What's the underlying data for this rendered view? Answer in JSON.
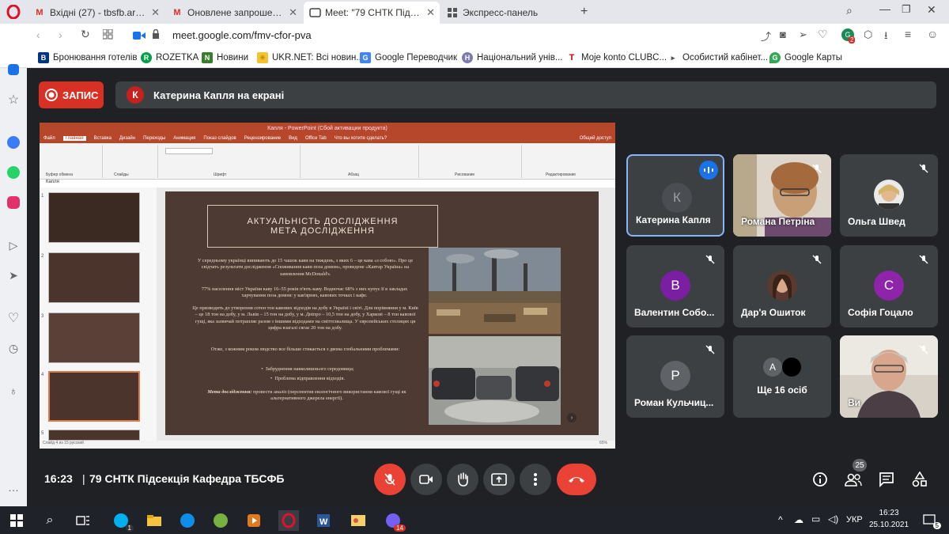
{
  "tabs": [
    {
      "title": "Вхідні (27) - tbsfb.archive@",
      "fav": "M"
    },
    {
      "title": "Оновлене запрошення: 79",
      "fav": "M"
    },
    {
      "title": "Meet: \"79 СНТК Підсекція",
      "fav": "meet"
    },
    {
      "title": "Экспресс-панель",
      "fav": "grid"
    }
  ],
  "address": {
    "url": "meet.google.com/fmv-cfor-pva",
    "ext_badge": "2"
  },
  "bookmarks": [
    {
      "label": "Бронювання готелів",
      "color": "#003580",
      "glyph": "B"
    },
    {
      "label": "ROZETKA",
      "color": "#00a046",
      "glyph": "R"
    },
    {
      "label": "Новини",
      "color": "#3a7d2c",
      "glyph": "N"
    },
    {
      "label": "UKR.NET: Всі новин...",
      "color": "#f4c430",
      "glyph": "☀"
    },
    {
      "label": "Google Переводчик",
      "color": "#4285f4",
      "glyph": "G"
    },
    {
      "label": "Національний унів...",
      "color": "#7b7bb0",
      "glyph": "Н"
    },
    {
      "label": "Moje konto CLUBC...",
      "color": "#d50000",
      "glyph": "T"
    },
    {
      "label": "Особистий кабінет...",
      "color": "#555",
      "glyph": "▸"
    },
    {
      "label": "Google Карты",
      "color": "#34a853",
      "glyph": "G"
    }
  ],
  "meet": {
    "record_label": "ЗАПИС",
    "presenter_initial": "К",
    "presenter_text": "Катерина Капля на екрані",
    "time": "16:23",
    "meeting_title": "79 СНТК Підсекція Кафедра ТБСФБ",
    "participants_count": "25"
  },
  "shared": {
    "window_title": "Капля - PowerPoint (Сбой активации продукта)",
    "ribbon_tabs": [
      "Файл",
      "Главная",
      "Вставка",
      "Дизайн",
      "Переходы",
      "Анимация",
      "Показ слайдов",
      "Рецензирование",
      "Вид",
      "Office Tab",
      "Что вы хотите сделать?",
      "Общий доступ"
    ],
    "ribbon_groups": [
      "Буфер обмена",
      "Слайды",
      "Шрифт",
      "Абзац",
      "Рисование",
      "Редактирование"
    ],
    "pane_title": "Капля",
    "slide_title_1": "АКТУАЛЬНІСТЬ ДОСЛІДЖЕННЯ",
    "slide_title_2": "МЕТА ДОСЛІДЖЕННЯ",
    "p1": "У середньому українці випивають до 15 чашок кави на тиждень, з яких 6 – це кава «з собою». Про це свідчать результати дослідження «Споживання кави поза домом», проведене «Кавтар Україна» на замовлення McDonald's.",
    "p2": "77% населення міст України каву 16–55 років п'ють каву. Водночас 68% з них купує її в закладах харчування поза домом: у кав'ярнях, кавових точках і кафе.",
    "p3": "Це призводить до утворення сотен тон кавових відходів на добу в Україні і світі. Для порівняння у м. Київ – це 18 тон на добу, у м. Львів – 15 тон на добу, у м. Дніпро – 10,5 тон на добу, у Харкові – 8 тон кавової гущі, яка зазвичай потрапляє разом з іншими відходами на сміттєзвалища. У європейських столицях ця цифра взагалі сягає 20 тон на добу.",
    "p4": "Отже, з кожним роком людство все більше стикається з двома глобальними проблемами:",
    "b1": "Забруднення навколишнього середовища;",
    "b2": "Проблема відправлення відходів.",
    "p5_bold": "Мета дослідження:",
    "p5": " провести аналіз (перспектив екологічного використання кавової гущі як альтернативного джерела енергії).",
    "status": "Слайд 4 из 15   русский",
    "zoom": "65%",
    "thumb_numbers": [
      "1",
      "2",
      "3",
      "4",
      "5"
    ]
  },
  "participants": [
    {
      "name": "Катерина Капля",
      "initial": "К",
      "color": "#4a4d51",
      "kind": "initial"
    },
    {
      "name": "Романа Петріна",
      "kind": "photo",
      "photo": "romana"
    },
    {
      "name": "Ольга Швед",
      "kind": "small-photo"
    },
    {
      "name": "Валентин Собо...",
      "initial": "В",
      "color": "#7b1fa2",
      "kind": "initial"
    },
    {
      "name": "Дар'я Ошиток",
      "kind": "small-photo2"
    },
    {
      "name": "Софія Гоцало",
      "initial": "С",
      "color": "#8e24aa",
      "kind": "initial"
    },
    {
      "name": "Роман Кульчиц...",
      "initial": "Р",
      "color": "#5f6368",
      "kind": "initial"
    },
    {
      "name": "Ще 16 осіб",
      "initial": "А",
      "kind": "more"
    },
    {
      "name": "Ви",
      "kind": "photo",
      "photo": "self"
    }
  ],
  "taskbar": {
    "lang": "УКР",
    "clock_time": "16:23",
    "clock_date": "25.10.2021",
    "skype_badge": "1",
    "viber_badge": "14",
    "notif_badge": "5"
  }
}
